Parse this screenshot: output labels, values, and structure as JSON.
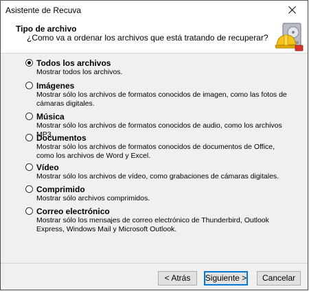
{
  "window": {
    "title": "Asistente de Recuva"
  },
  "header": {
    "title": "Tipo de archivo",
    "subtitle": "¿Como va a ordenar los archivos que está tratando de recuperar?"
  },
  "options": [
    {
      "label": "Todos los archivos",
      "description": "Mostrar todos los archivos.",
      "checked": true
    },
    {
      "label": "Imágenes",
      "description": "Mostrar sólo los archivos de formatos conocidos de imagen, como las fotos de cámaras digitales.",
      "checked": false
    },
    {
      "label": "Música",
      "description": "Mostrar sólo los archivos de formatos conocidos de audio, como los archivos MP3.",
      "checked": false
    },
    {
      "label": "Documentos",
      "description": "Mostrar sólo los archivos de formatos conocidos de documentos de Office, como los archivos de Word y Excel.",
      "checked": false
    },
    {
      "label": "Vídeo",
      "description": "Mostrar sólo los archivos de vídeo, como grabaciones de cámaras digitales.",
      "checked": false
    },
    {
      "label": "Comprimido",
      "description": "Mostrar sólo archivos comprimidos.",
      "checked": false
    },
    {
      "label": "Correo electrónico",
      "description": "Mostrar sólo los mensajes de correo electrónico de Thunderbird, Outlook Express, Windows Mail y Microsoft Outlook.",
      "checked": false
    }
  ],
  "buttons": {
    "back": "< Atrás",
    "next": "Siguiente >",
    "cancel": "Cancelar"
  },
  "icons": {
    "close": "close-icon",
    "logo": "recuva-hard-hat-icon"
  }
}
